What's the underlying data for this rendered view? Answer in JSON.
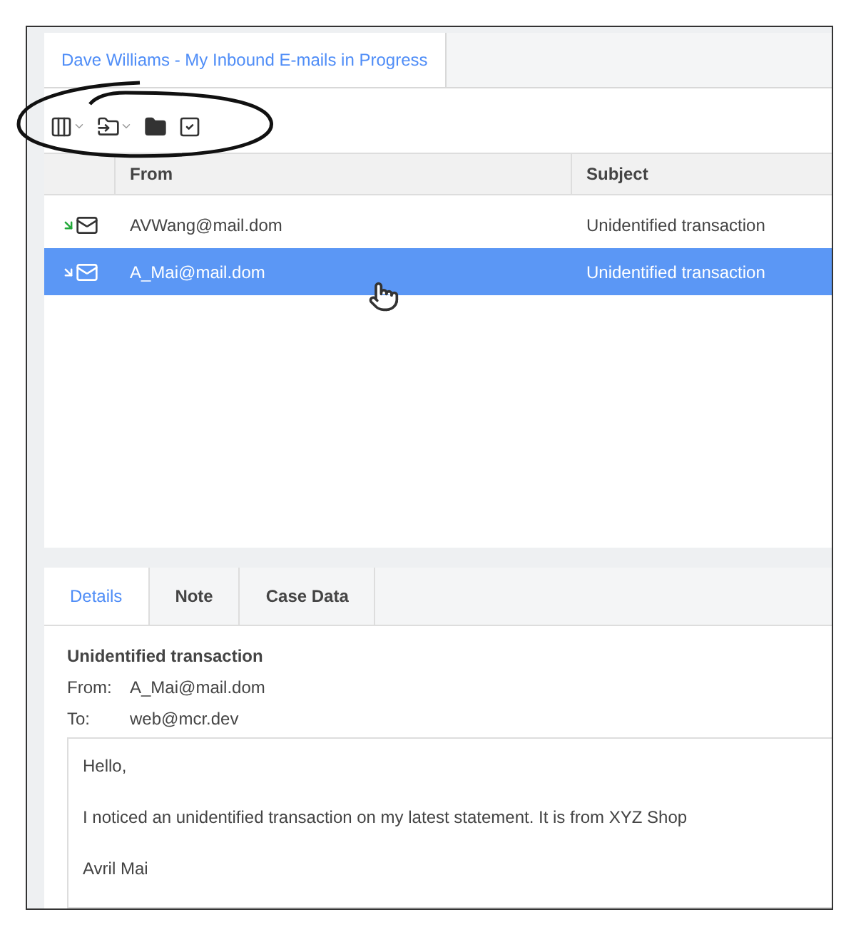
{
  "main_tab": {
    "label": "Dave Williams - My Inbound E-mails in Progress",
    "selected": true
  },
  "table": {
    "columns": [
      "From",
      "Subject"
    ],
    "rows": [
      {
        "from": "AVWang@mail.dom",
        "subject": "Unidentified transaction",
        "selected": false
      },
      {
        "from": "A_Mai@mail.dom",
        "subject": "Unidentified transaction",
        "selected": true
      }
    ]
  },
  "detail_tabs": [
    {
      "label": "Details",
      "selected": true
    },
    {
      "label": "Note",
      "selected": false
    },
    {
      "label": "Case Data",
      "selected": false
    }
  ],
  "email": {
    "subject": "Unidentified transaction",
    "from_label": "From:",
    "from": "A_Mai@mail.dom",
    "to_label": "To:",
    "to": "web@mcr.dev",
    "body": [
      "Hello,",
      "I noticed an unidentified transaction on my latest statement. It is from XYZ Shop",
      "Avril Mai"
    ]
  }
}
